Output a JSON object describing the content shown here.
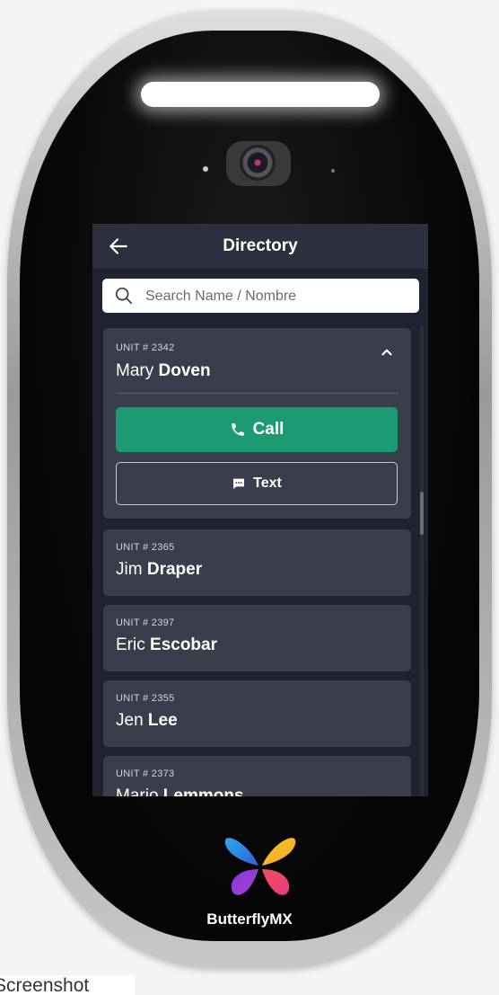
{
  "header": {
    "title": "Directory"
  },
  "search": {
    "placeholder": "Search Name / Nombre"
  },
  "directory": {
    "entries": [
      {
        "unit": "UNIT # 2342",
        "first": "Mary",
        "last": "Doven",
        "expanded": true,
        "actions": {
          "call": "Call",
          "text": "Text"
        }
      },
      {
        "unit": "UNIT # 2365",
        "first": "Jim",
        "last": "Draper"
      },
      {
        "unit": "UNIT # 2397",
        "first": "Eric",
        "last": "Escobar"
      },
      {
        "unit": "UNIT # 2355",
        "first": "Jen",
        "last": "Lee"
      },
      {
        "unit": "UNIT # 2373",
        "first": "Mario",
        "last": "Lemmons"
      }
    ]
  },
  "brand": {
    "name": "ButterflyMX"
  },
  "caption": {
    "text": "Screenshot"
  },
  "colors": {
    "screen_bg": "#1f2230",
    "card_bg": "#3a3d4b",
    "call_green": "#1c9a74"
  }
}
